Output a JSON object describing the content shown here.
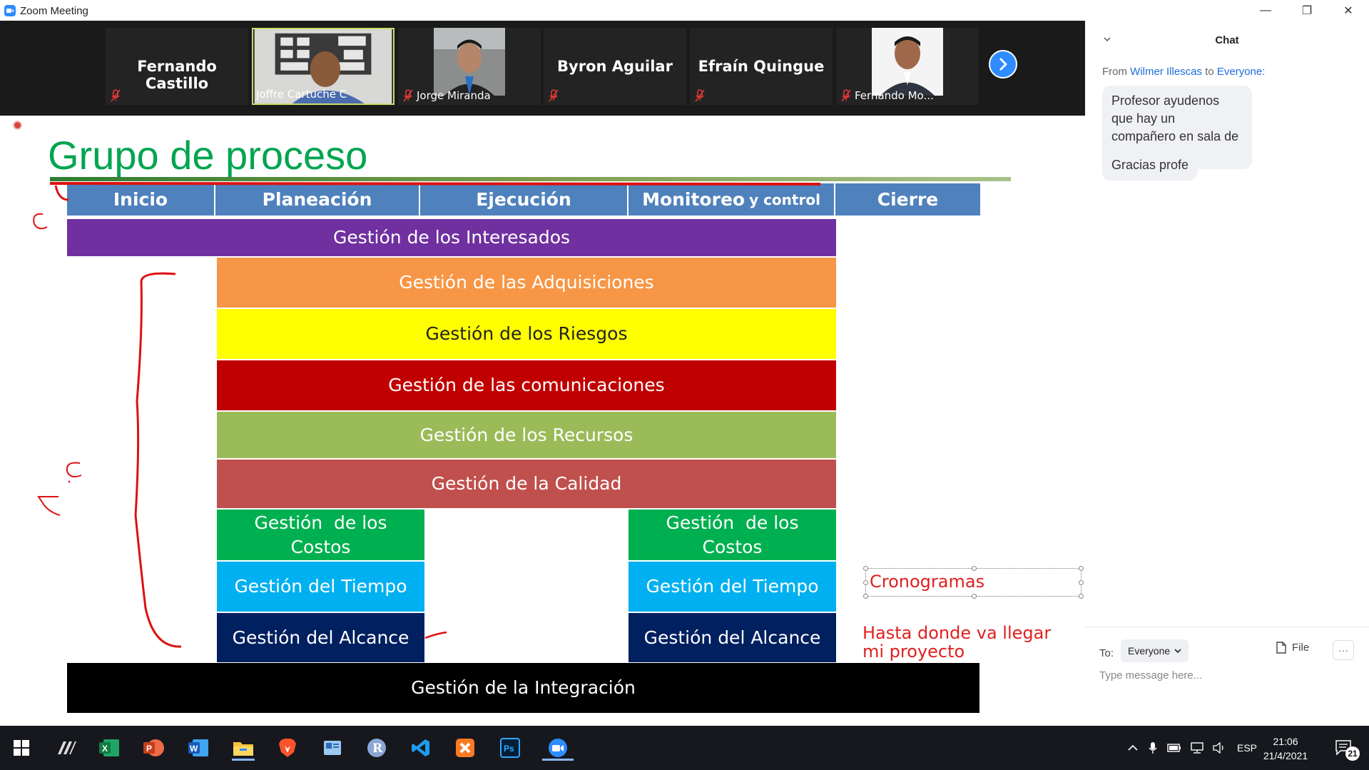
{
  "window": {
    "title": "Zoom Meeting",
    "minimize": "—",
    "restore": "❐",
    "close": "✕"
  },
  "participants": [
    {
      "name": "Fernando Castillo",
      "muted": true
    },
    {
      "name": "Joffre Cartuche C",
      "muted": false,
      "video": true,
      "active": true
    },
    {
      "name": "Jorge Miranda",
      "muted": true,
      "video": true
    },
    {
      "name": "Byron Aguilar",
      "muted": true
    },
    {
      "name": "Efraín Quingue",
      "muted": true
    },
    {
      "name": "Fernando Mo...",
      "muted": true,
      "video": true
    }
  ],
  "slide": {
    "title": "Grupo de proceso",
    "phases": [
      "Inicio",
      "Planeación",
      "Ejecución",
      "Monitoreo",
      "y control",
      "Cierre"
    ],
    "bands": {
      "interesados": "Gestión de los Interesados",
      "adquisiciones": "Gestión de las Adquisiciones",
      "riesgos": "Gestión de los Riesgos",
      "comunicaciones": "Gestión de las comunicaciones",
      "recursos": "Gestión de los Recursos",
      "calidad": "Gestión de la Calidad",
      "costos_left_1": "Gestión  de los",
      "costos_left_2": "Costos",
      "tiempo_left": "Gestión del Tiempo",
      "alcance_left": "Gestión del Alcance",
      "costos_right_1": "Gestión  de los",
      "costos_right_2": "Costos",
      "tiempo_right": "Gestión del Tiempo",
      "alcance_right": "Gestión del Alcance",
      "integracion": "Gestión de la Integración"
    },
    "annotations": {
      "cronogramas": "Cronogramas",
      "hasta_1": "Hasta donde va llegar",
      "hasta_2": "mi proyecto"
    },
    "colors": {
      "phase": "#4f81bd",
      "interesados": "#7030a0",
      "adquisiciones": "#f79646",
      "riesgos": "#ffff00",
      "comunicaciones": "#c00000",
      "recursos": "#9bbb59",
      "calidad": "#c0504d",
      "costos": "#00b050",
      "tiempo": "#00b0f0",
      "alcance": "#002060",
      "integracion": "#000000",
      "annotation": "#e02020"
    }
  },
  "chat": {
    "title": "Chat",
    "from_prefix": "From",
    "from_name": "Wilmer Illescas",
    "from_to": "to",
    "from_target": "Everyone:",
    "messages": [
      "Profesor ayudenos que hay un compañero en sala de espera",
      "Gracias profe"
    ],
    "to_label": "To:",
    "to_value": "Everyone",
    "file_label": "File",
    "more_label": "···",
    "input_placeholder": "Type message here..."
  },
  "taskbar": {
    "apps": [
      "windows-start",
      "arc-app",
      "excel",
      "powerpoint",
      "word",
      "file-explorer",
      "brave",
      "contacts",
      "r-app",
      "vscode",
      "xampp",
      "photoshop",
      "zoom"
    ],
    "language": "ESP",
    "time": "21:06",
    "date": "21/4/2021",
    "notifications": "21"
  }
}
